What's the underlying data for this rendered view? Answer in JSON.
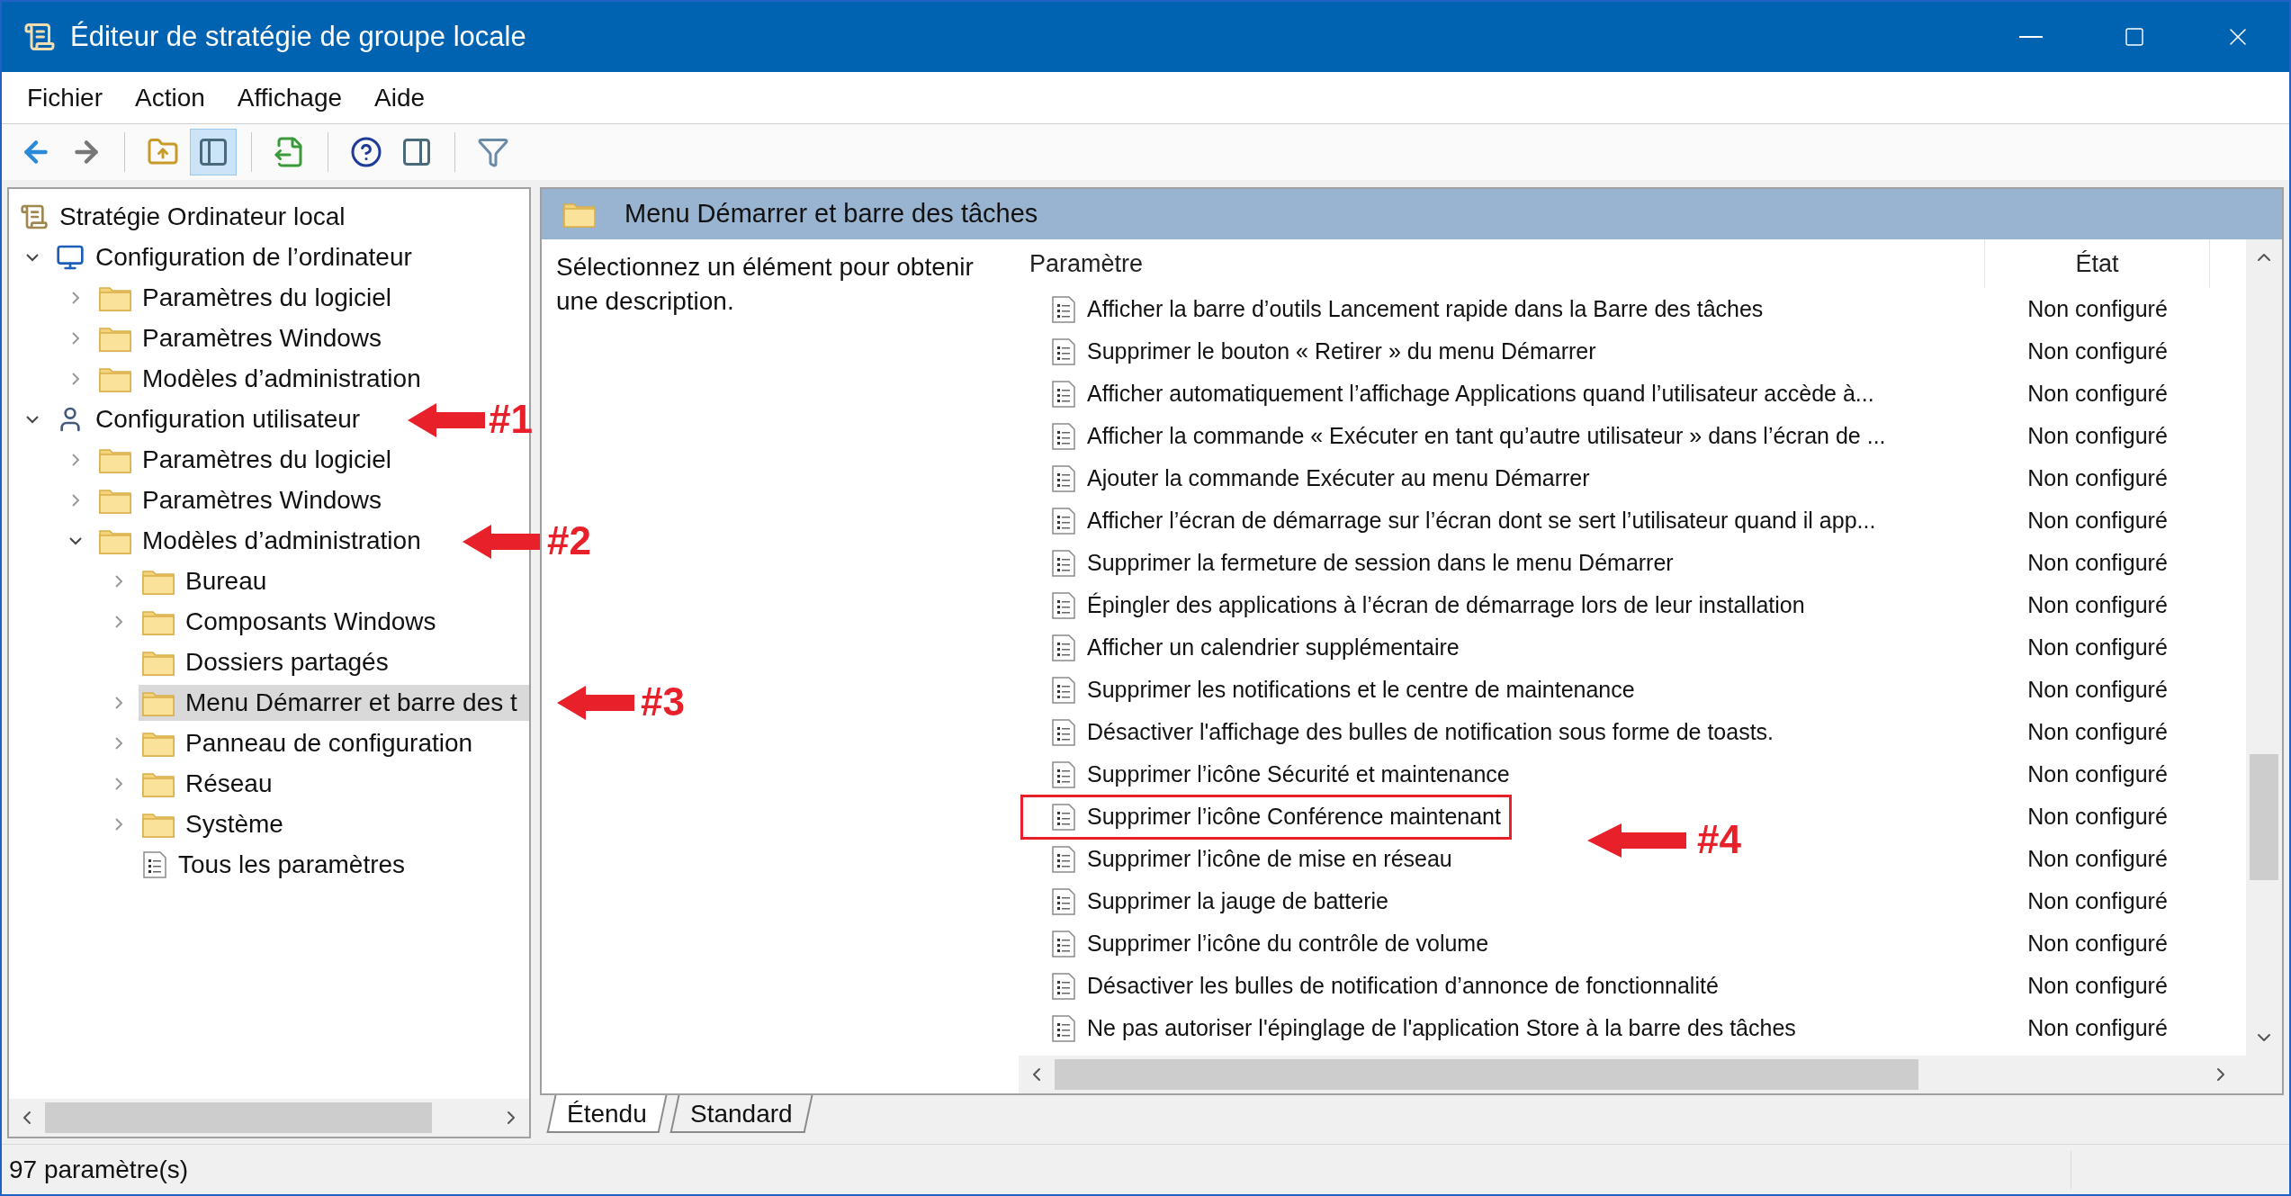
{
  "window": {
    "title": "Éditeur de stratégie de groupe locale"
  },
  "menu": [
    "Fichier",
    "Action",
    "Affichage",
    "Aide"
  ],
  "toolbar": [
    {
      "pressed": false
    },
    {
      "pressed": false
    },
    {
      "pressed": false
    },
    {
      "pressed": true
    },
    {
      "pressed": false
    },
    {
      "pressed": false
    },
    {
      "pressed": false
    },
    {
      "pressed": false
    }
  ],
  "tree": {
    "root": {
      "label": "Stratégie Ordinateur local",
      "children": [
        {
          "label": "Configuration de l’ordinateur",
          "kind": "computer",
          "expandable": true,
          "expanded": true,
          "selected": false,
          "children": [
            {
              "label": "Paramètres du logiciel",
              "kind": "folder",
              "expandable": true,
              "expanded": false,
              "selected": false
            },
            {
              "label": "Paramètres Windows",
              "kind": "folder",
              "expandable": true,
              "expanded": false,
              "selected": false
            },
            {
              "label": "Modèles d’administration",
              "kind": "folder",
              "expandable": true,
              "expanded": false,
              "selected": false
            }
          ]
        },
        {
          "label": "Configuration utilisateur",
          "kind": "user",
          "expandable": true,
          "expanded": true,
          "selected": false,
          "children": [
            {
              "label": "Paramètres du logiciel",
              "kind": "folder",
              "expandable": true,
              "expanded": false,
              "selected": false
            },
            {
              "label": "Paramètres Windows",
              "kind": "folder",
              "expandable": true,
              "expanded": false,
              "selected": false
            },
            {
              "label": "Modèles d’administration",
              "kind": "folder",
              "expandable": true,
              "expanded": true,
              "selected": false,
              "children": [
                {
                  "label": "Bureau",
                  "kind": "folder",
                  "expandable": true,
                  "expanded": false,
                  "selected": false
                },
                {
                  "label": "Composants Windows",
                  "kind": "folder",
                  "expandable": true,
                  "expanded": false,
                  "selected": false
                },
                {
                  "label": "Dossiers partagés",
                  "kind": "folder",
                  "expandable": false,
                  "selected": false
                },
                {
                  "label": "Menu Démarrer et barre des t",
                  "kind": "folder",
                  "expandable": true,
                  "expanded": false,
                  "selected": true
                },
                {
                  "label": "Panneau de configuration",
                  "kind": "folder",
                  "expandable": true,
                  "expanded": false,
                  "selected": false
                },
                {
                  "label": "Réseau",
                  "kind": "folder",
                  "expandable": true,
                  "expanded": false,
                  "selected": false
                },
                {
                  "label": "Système",
                  "kind": "folder",
                  "expandable": true,
                  "expanded": false,
                  "selected": false
                },
                {
                  "label": "Tous les paramètres",
                  "kind": "all",
                  "expandable": false,
                  "selected": false
                }
              ]
            }
          ]
        }
      ]
    }
  },
  "details": {
    "title": "Menu Démarrer et barre des tâches",
    "description": "Sélectionnez un élément pour obtenir une description.",
    "columns": [
      "Paramètre",
      "État"
    ],
    "rows": [
      {
        "name": "Afficher la barre d’outils Lancement rapide dans la Barre des tâches",
        "state": "Non configuré",
        "boxed": false
      },
      {
        "name": "Supprimer le bouton « Retirer » du menu Démarrer",
        "state": "Non configuré",
        "boxed": false
      },
      {
        "name": "Afficher automatiquement l’affichage Applications quand l’utilisateur accède à...",
        "state": "Non configuré",
        "boxed": false
      },
      {
        "name": "Afficher la commande « Exécuter en tant qu’autre utilisateur » dans l’écran de ...",
        "state": "Non configuré",
        "boxed": false
      },
      {
        "name": "Ajouter la commande Exécuter au menu Démarrer",
        "state": "Non configuré",
        "boxed": false
      },
      {
        "name": "Afficher l’écran de démarrage sur l’écran dont se sert l’utilisateur quand il app...",
        "state": "Non configuré",
        "boxed": false
      },
      {
        "name": "Supprimer la fermeture de session dans le menu Démarrer",
        "state": "Non configuré",
        "boxed": false
      },
      {
        "name": "Épingler des applications à l’écran de démarrage lors de leur installation",
        "state": "Non configuré",
        "boxed": false
      },
      {
        "name": "Afficher un calendrier supplémentaire",
        "state": "Non configuré",
        "boxed": false
      },
      {
        "name": "Supprimer les notifications et le centre de maintenance",
        "state": "Non configuré",
        "boxed": false
      },
      {
        "name": "Désactiver l'affichage des bulles de notification sous forme de toasts.",
        "state": "Non configuré",
        "boxed": false
      },
      {
        "name": "Supprimer l’icône Sécurité et maintenance",
        "state": "Non configuré",
        "boxed": false
      },
      {
        "name": "Supprimer l’icône Conférence maintenant",
        "state": "Non configuré",
        "boxed": true
      },
      {
        "name": "Supprimer l’icône de mise en réseau",
        "state": "Non configuré",
        "boxed": false
      },
      {
        "name": "Supprimer la jauge de batterie",
        "state": "Non configuré",
        "boxed": false
      },
      {
        "name": "Supprimer l’icône du contrôle de volume",
        "state": "Non configuré",
        "boxed": false
      },
      {
        "name": "Désactiver les bulles de notification d’annonce de fonctionnalité",
        "state": "Non configuré",
        "boxed": false
      },
      {
        "name": "Ne pas autoriser l'épinglage de l'application Store à la barre des tâches",
        "state": "Non configuré",
        "boxed": false
      }
    ],
    "tabs": [
      {
        "label": "Étendu",
        "selected": true
      },
      {
        "label": "Standard",
        "selected": false
      }
    ]
  },
  "status_bar": "97 paramètre(s)",
  "annotations": [
    {
      "label": "#1"
    },
    {
      "label": "#2"
    },
    {
      "label": "#3"
    },
    {
      "label": "#4"
    }
  ]
}
